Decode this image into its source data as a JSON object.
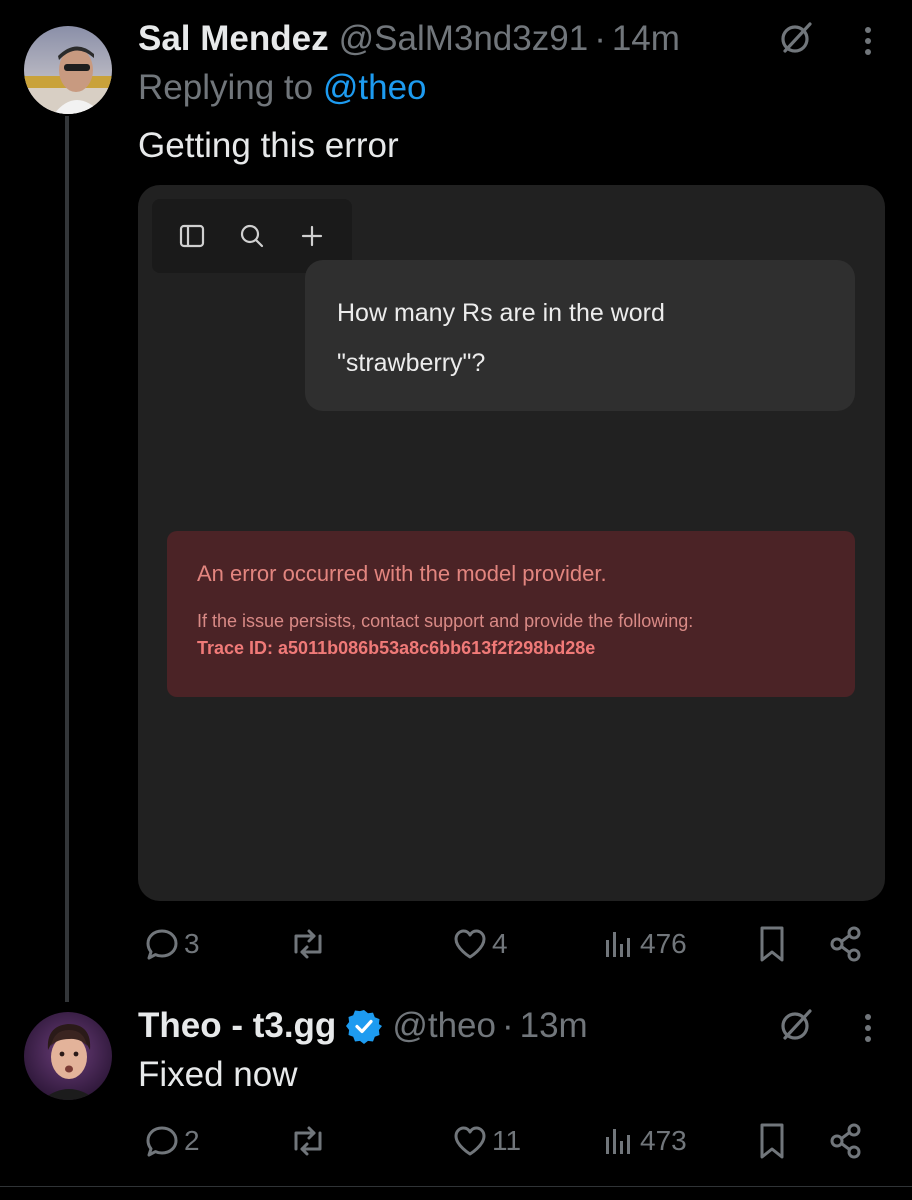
{
  "tweet1": {
    "author_name": "Sal Mendez",
    "handle": "@SalM3nd3z91",
    "separator": "·",
    "time": "14m",
    "replying_label": "Replying to",
    "replying_to": "@theo",
    "text": "Getting this error",
    "media": {
      "toolbar_icons": [
        "sidebar-toggle-icon",
        "search-icon",
        "plus-icon"
      ],
      "user_message_line1": "How many Rs are in the word",
      "user_message_line2": "\"strawberry\"?",
      "error_title": "An error occurred with the model provider.",
      "error_subtitle": "If the issue persists, contact support and provide the following:",
      "error_trace": "Trace ID: a5011b086b53a8c6bb613f2f298bd28e"
    },
    "stats": {
      "replies": "3",
      "reposts": "",
      "likes": "4",
      "views": "476"
    }
  },
  "tweet2": {
    "author_name": "Theo - t3.gg",
    "verified": true,
    "handle": "@theo",
    "separator": "·",
    "time": "13m",
    "text": "Fixed now",
    "stats": {
      "replies": "2",
      "reposts": "",
      "likes": "11",
      "views": "473"
    }
  },
  "colors": {
    "background": "#000000",
    "text": "#e7e9ea",
    "muted": "#71767b",
    "link": "#1d9bf0",
    "verified": "#1d9bf0",
    "error_bg": "#4b2326",
    "error_text": "#e0807c"
  }
}
